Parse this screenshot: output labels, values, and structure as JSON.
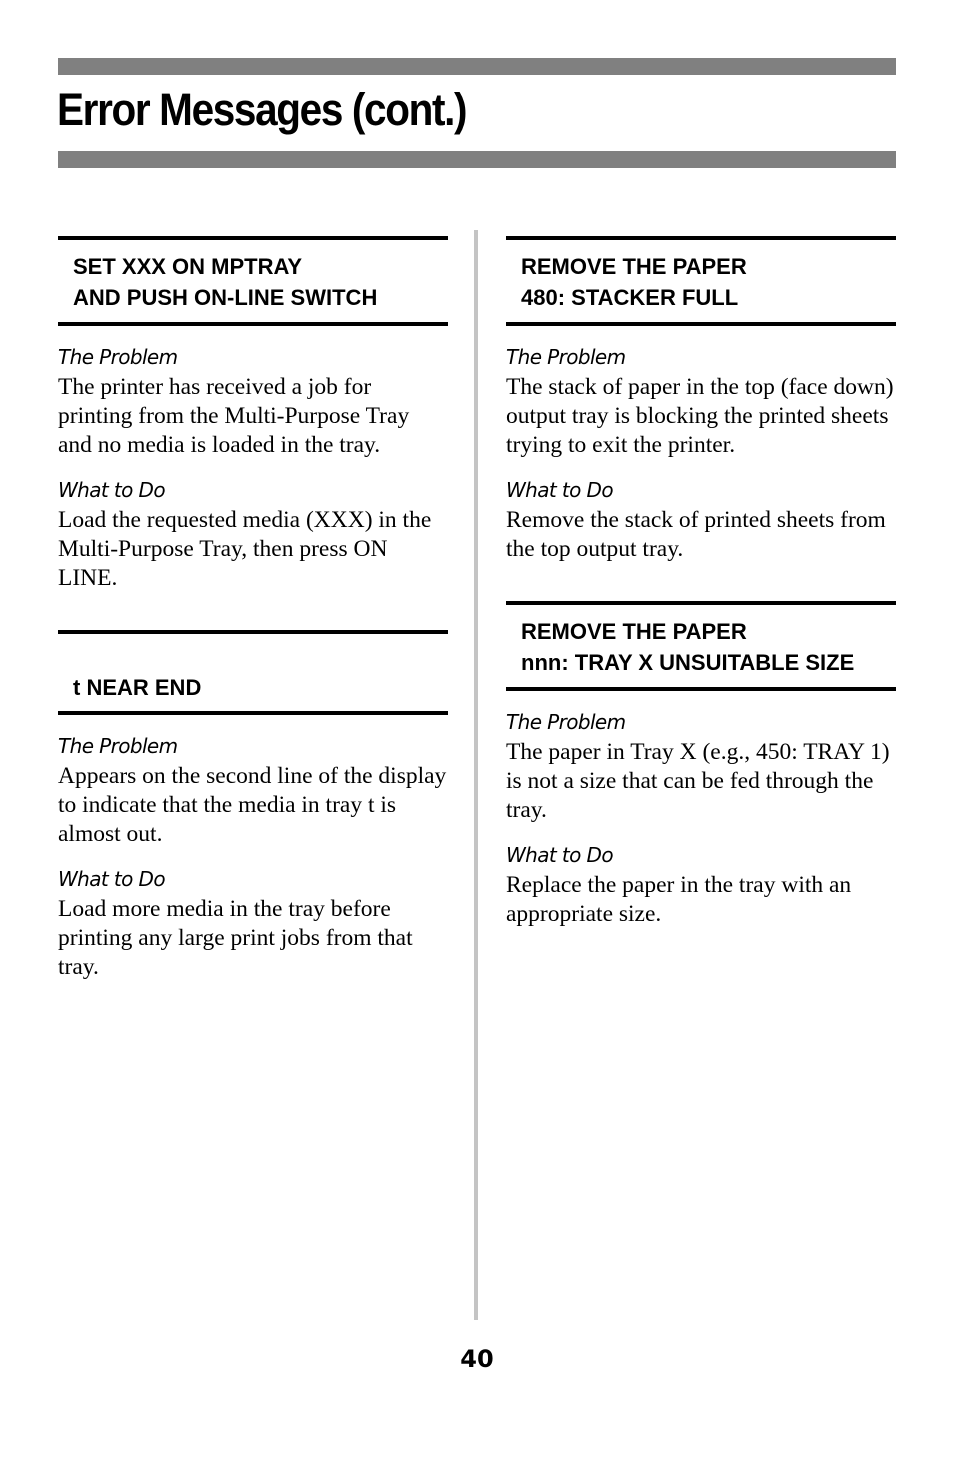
{
  "page": {
    "title": "Error Messages (cont.)",
    "page_number": "40"
  },
  "left_column": [
    {
      "heading_lines": [
        "SET XXX ON MPTRAY",
        "AND PUSH ON-LINE SWITCH"
      ],
      "problem_label": "The Problem",
      "problem_text": "The printer has received a job for printing from the Multi-Purpose Tray and no media is loaded in the tray.",
      "action_label": "What to Do",
      "action_text": "Load the requested media (XXX) in the Multi-Purpose Tray, then press ON LINE."
    },
    {
      "heading_lines": [
        "t NEAR END"
      ],
      "problem_label": "The Problem",
      "problem_text": "Appears on the second line of the display to indicate that the media in tray t is almost out.",
      "action_label": "What to Do",
      "action_text": "Load more media in the tray before printing any large print jobs from that tray."
    }
  ],
  "right_column": [
    {
      "heading_lines": [
        "REMOVE THE PAPER",
        "480: STACKER FULL"
      ],
      "problem_label": "The Problem",
      "problem_text": "The stack of paper in the top (face down) output tray is blocking the printed sheets trying to exit the printer.",
      "action_label": "What to Do",
      "action_text": "Remove the stack of printed sheets from the top output tray."
    },
    {
      "heading_lines": [
        "REMOVE THE PAPER",
        "nnn: TRAY X UNSUITABLE SIZE"
      ],
      "problem_label": "The Problem",
      "problem_text": "The paper in Tray X (e.g., 450: TRAY 1) is not a size that can be fed through the tray.",
      "action_label": "What to Do",
      "action_text": "Replace the paper in the tray with an appropriate size."
    }
  ]
}
